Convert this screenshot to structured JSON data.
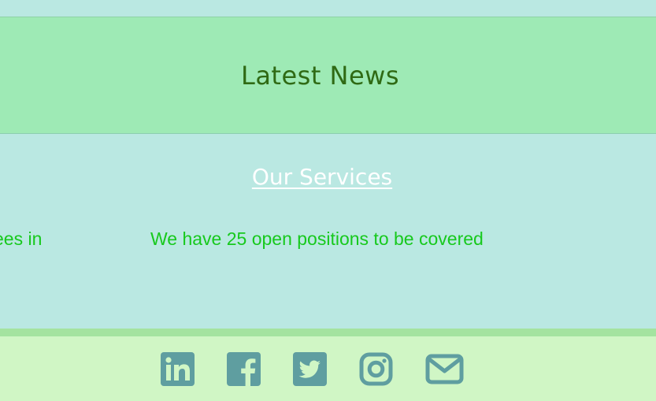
{
  "news": {
    "title": "Latest News"
  },
  "services": {
    "title": "Our Services",
    "items": [
      "ees in",
      "We have 25 open positions to be covered"
    ]
  },
  "footer": {
    "icons": [
      "linkedin-icon",
      "facebook-icon",
      "twitter-icon",
      "instagram-icon",
      "mail-icon"
    ]
  },
  "colors": {
    "background": "#bae8e2",
    "news_band": "#9eeab5",
    "news_title": "#2f6a14",
    "services_title": "#ffffff",
    "item_text": "#17c91d",
    "footer": "#d0f6c5",
    "footer_border": "#a4e3a0",
    "icon": "#5f9ea0"
  }
}
